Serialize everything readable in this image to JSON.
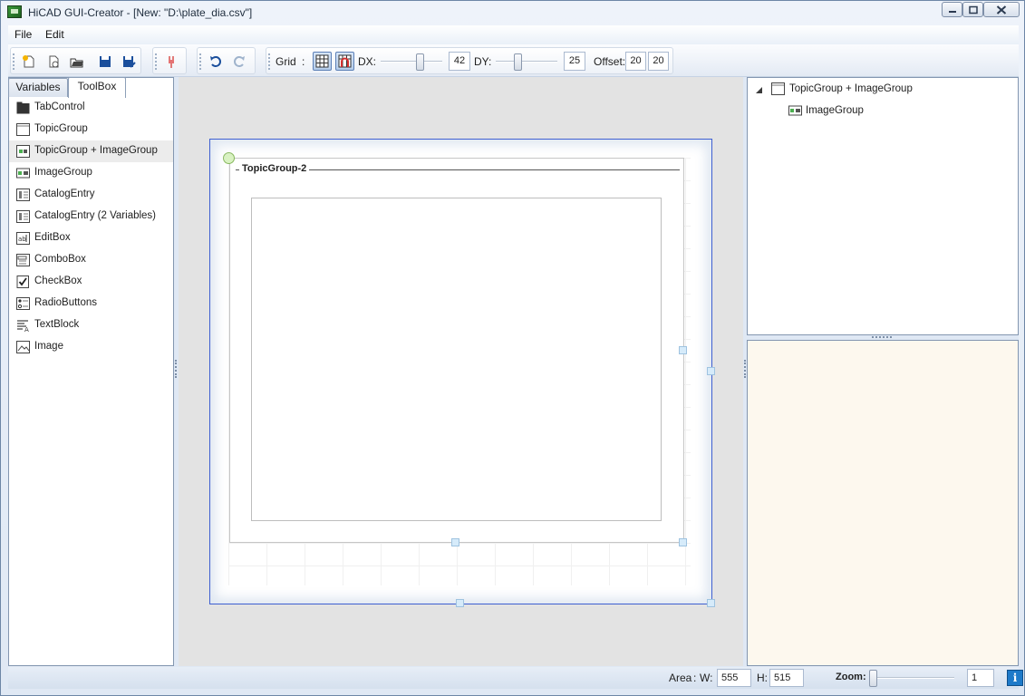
{
  "window": {
    "title": "HiCAD GUI-Creator - [New: \"D:\\plate_dia.csv\"]"
  },
  "menu": [
    "File",
    "Edit"
  ],
  "toolbar": {
    "grid_label": "Grid",
    "grid_colon": ":",
    "dx_label": "DX:",
    "dx_value": "42",
    "dy_label": "DY:",
    "dy_value": "25",
    "offset_label": "Offset:",
    "offset_x": "20",
    "offset_y": "20"
  },
  "tabs": {
    "variables": "Variables",
    "toolbox": "ToolBox"
  },
  "toolbox": [
    {
      "label": "TabControl",
      "icon": "tabcontrol-icon"
    },
    {
      "label": "TopicGroup",
      "icon": "topicgroup-icon"
    },
    {
      "label": "TopicGroup + ImageGroup",
      "icon": "topicgroup-imagegroup-icon"
    },
    {
      "label": "ImageGroup",
      "icon": "imagegroup-icon"
    },
    {
      "label": "CatalogEntry",
      "icon": "catalogentry-icon"
    },
    {
      "label": "CatalogEntry (2 Variables)",
      "icon": "catalogentry-2-icon"
    },
    {
      "label": "EditBox",
      "icon": "editbox-icon"
    },
    {
      "label": "ComboBox",
      "icon": "combobox-icon"
    },
    {
      "label": "CheckBox",
      "icon": "checkbox-icon"
    },
    {
      "label": "RadioButtons",
      "icon": "radiobuttons-icon"
    },
    {
      "label": "TextBlock",
      "icon": "textblock-icon"
    },
    {
      "label": "Image",
      "icon": "image-icon"
    }
  ],
  "canvas": {
    "topic_group_title": "TopicGroup-2"
  },
  "tree": {
    "root": "TopicGroup + ImageGroup",
    "child": "ImageGroup"
  },
  "status": {
    "area_label": "Area",
    "area_colon": ":",
    "w_label": "W:",
    "w_value": "555",
    "h_label": "H:",
    "h_value": "515",
    "zoom_label": "Zoom:",
    "zoom_value": "1"
  },
  "colors": {
    "selection": "#3e5fd1",
    "props_bg": "#fdf8ee",
    "frame": "#6d86a6"
  }
}
